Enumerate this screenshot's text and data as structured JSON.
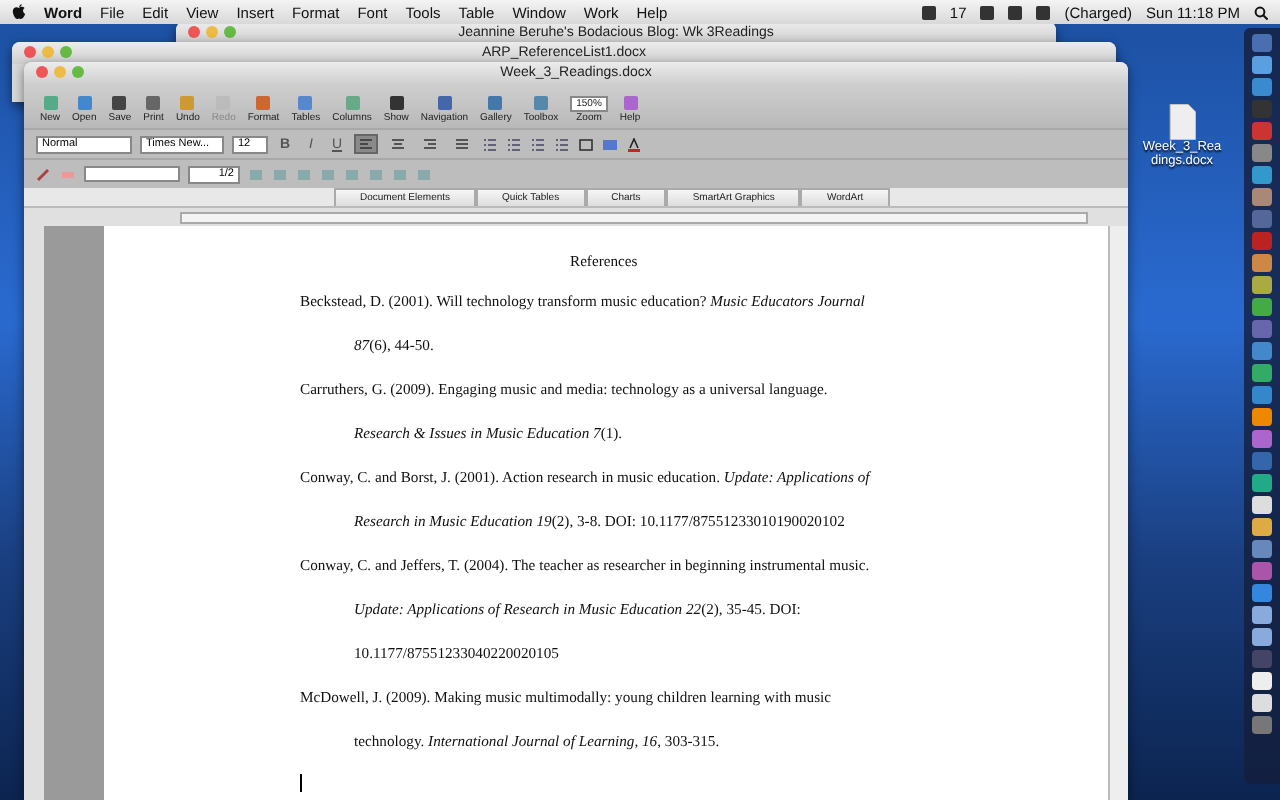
{
  "menubar": {
    "app": "Word",
    "menus": [
      "File",
      "Edit",
      "View",
      "Insert",
      "Format",
      "Font",
      "Tools",
      "Table",
      "Window",
      "Work",
      "Help"
    ],
    "status": [
      {
        "kind": "icon"
      },
      {
        "kind": "text",
        "text": "17"
      },
      {
        "kind": "icon"
      },
      {
        "kind": "icon"
      },
      {
        "kind": "icon"
      },
      {
        "kind": "text",
        "text": "(Charged)"
      },
      {
        "kind": "text",
        "text": "Sun 11:18 PM"
      }
    ]
  },
  "background_windows": [
    {
      "title": "Jeannine Beruhe's Bodacious Blog: Wk 3Readings"
    },
    {
      "title": "ARP_ReferenceList1.docx"
    }
  ],
  "window": {
    "title": "Week_3_Readings.docx"
  },
  "toolbar": [
    {
      "label": "New",
      "disabled": false
    },
    {
      "label": "Open",
      "disabled": false
    },
    {
      "label": "Save",
      "disabled": false
    },
    {
      "label": "Print",
      "disabled": false
    },
    {
      "label": "Undo",
      "disabled": false
    },
    {
      "label": "Redo",
      "disabled": true
    },
    {
      "label": "Format",
      "disabled": false
    },
    {
      "label": "Tables",
      "disabled": false
    },
    {
      "label": "Columns",
      "disabled": false
    },
    {
      "label": "Show",
      "disabled": false
    },
    {
      "label": "Navigation",
      "disabled": false
    },
    {
      "label": "Gallery",
      "disabled": false
    },
    {
      "label": "Toolbox",
      "disabled": false
    },
    {
      "label": "Zoom",
      "disabled": false,
      "value": "150%"
    },
    {
      "label": "Help",
      "disabled": false
    }
  ],
  "formatting": {
    "style": "Normal",
    "font": "Times New...",
    "size": "12",
    "bold": "B",
    "italic": "I",
    "underline": "U",
    "alignment": [
      {
        "selected": true
      },
      {
        "selected": false
      },
      {
        "selected": false
      },
      {
        "selected": false
      }
    ]
  },
  "drawing_bar": {
    "line_weight": "1/2"
  },
  "ribbon_tabs": [
    "Document Elements",
    "Quick Tables",
    "Charts",
    "SmartArt Graphics",
    "WordArt"
  ],
  "document": {
    "heading": "References",
    "references": [
      {
        "lines": [
          "Beckstead, D.  (2001).  Will technology transform music education?  *Music Educators Journal*",
          "*87*(6), 44-50."
        ]
      },
      {
        "lines": [
          "Carruthers, G.  (2009).  Engaging music and media: technology as a universal language.",
          "*Research & Issues in Music Education 7*(1)."
        ]
      },
      {
        "lines": [
          "Conway, C. and Borst, J.  (2001).  Action research in music education.  *Update:  Applications of*",
          "*Research in Music Education 19*(2), 3-8.  DOI:  10.1177/87551233010190020102"
        ]
      },
      {
        "lines": [
          "Conway, C. and Jeffers, T.  (2004).  The teacher as researcher in beginning instrumental music.",
          "*Update:  Applications of Research in Music Education 22*(2), 35-45.  DOI:",
          "10.1177/87551233040220020105"
        ]
      },
      {
        "lines": [
          "McDowell, J.  (2009).  Making music multimodally:  young children learning with music",
          "technology.  *International Journal of Learning, 16*, 303-315."
        ]
      }
    ]
  },
  "desktop": {
    "file_label": "Week_3_Readings.docx"
  }
}
